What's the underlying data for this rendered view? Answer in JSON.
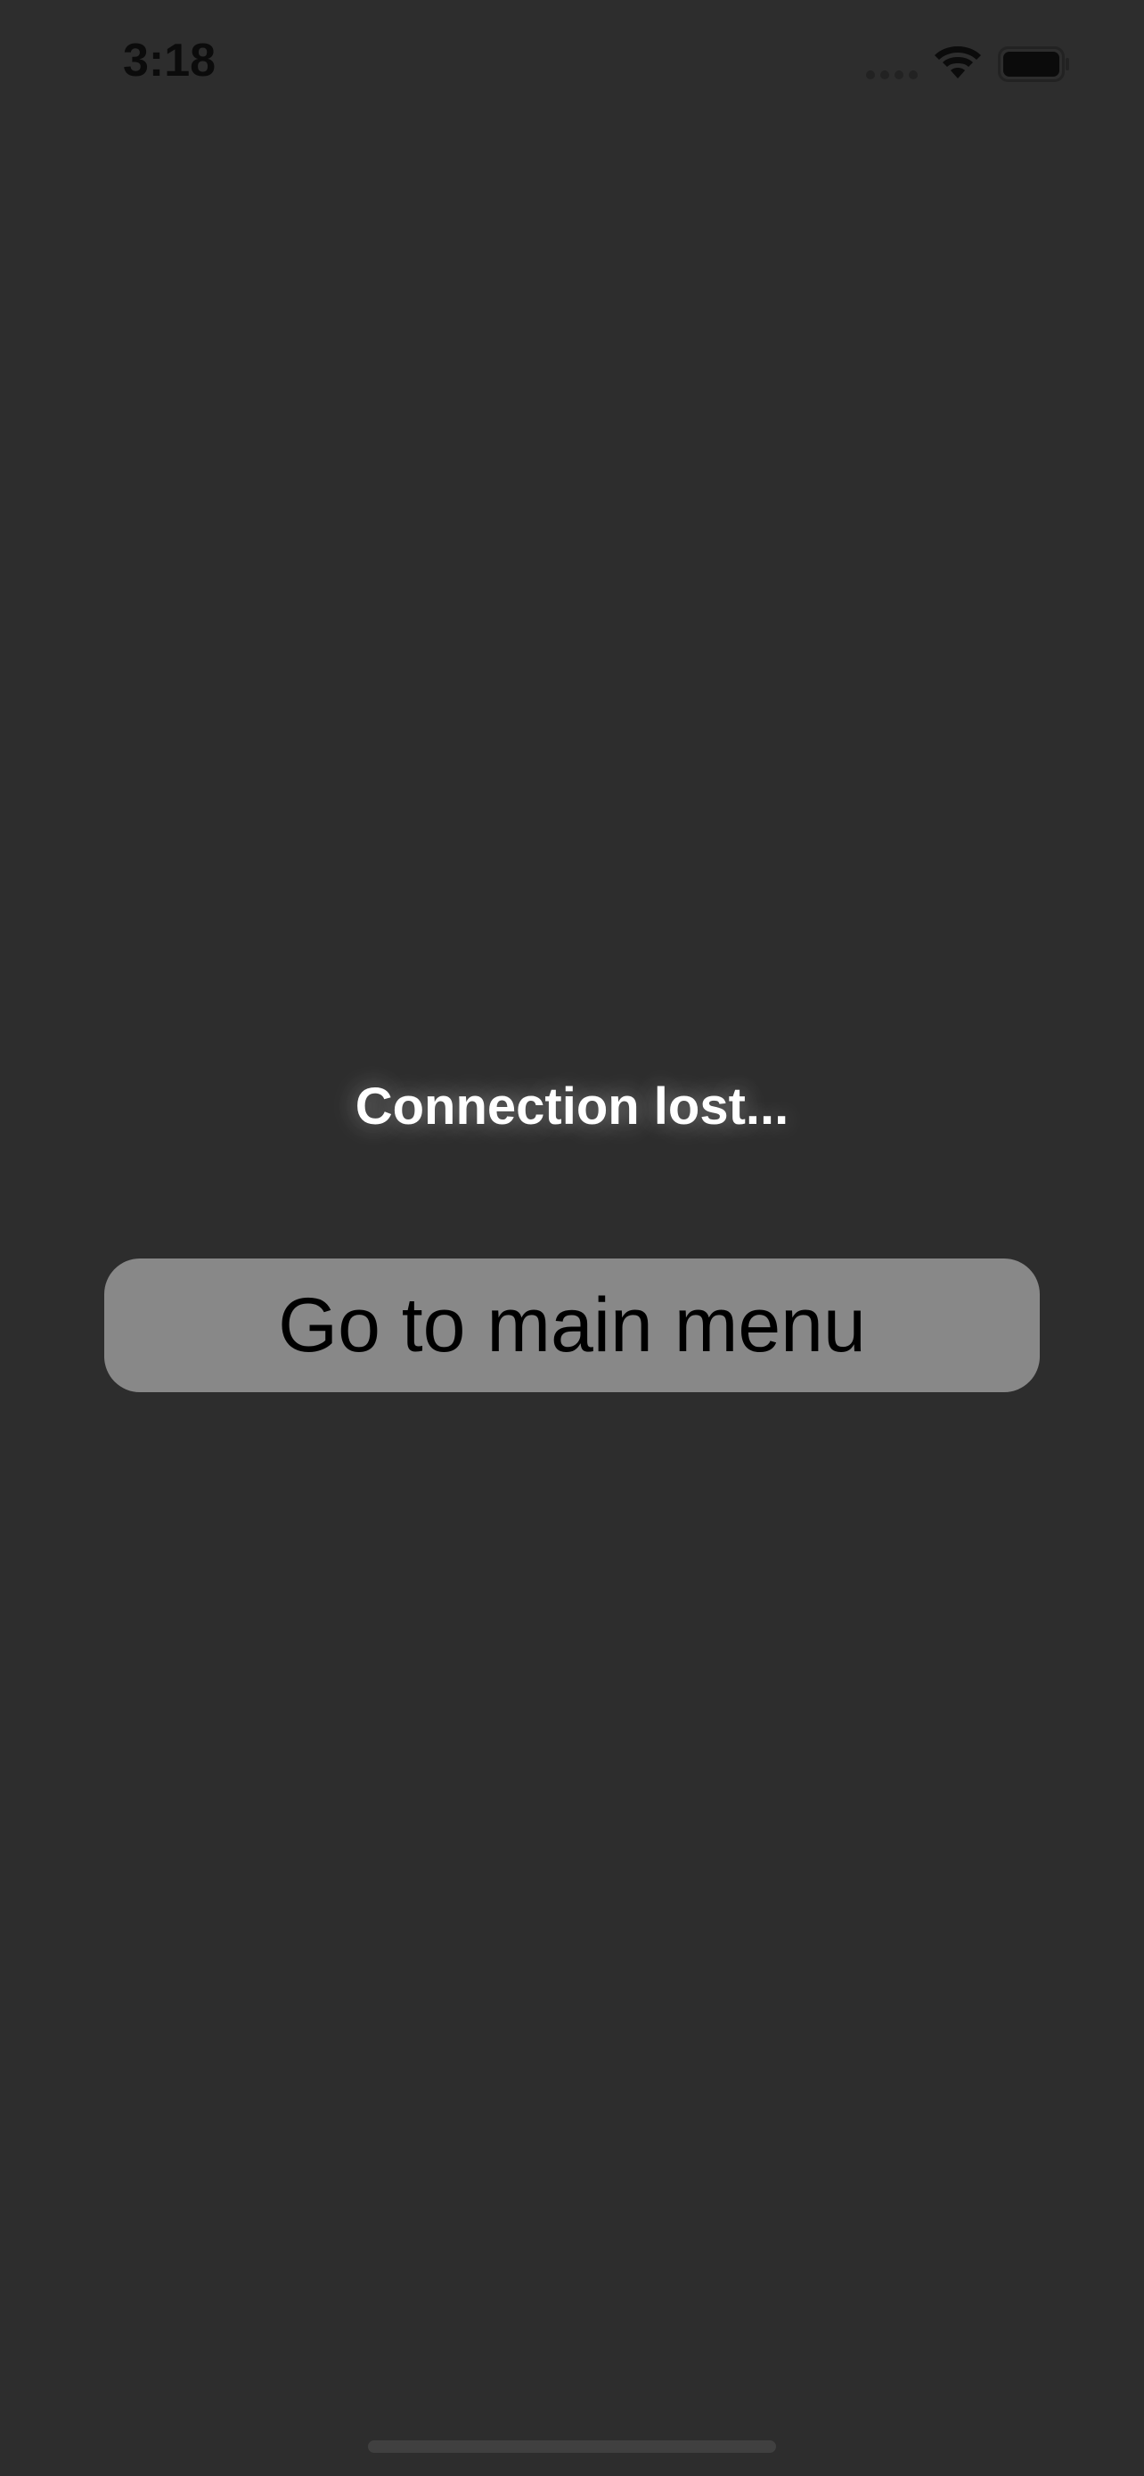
{
  "status_bar": {
    "time": "3:18",
    "wifi_icon": "wifi-icon",
    "battery_icon": "battery-icon",
    "signal_icon": "cellular-signal-dots-icon"
  },
  "main": {
    "message": "Connection lost...",
    "button_label": "Go to main menu"
  },
  "colors": {
    "background": "#2d2d2d",
    "button_background": "#888888",
    "message_text": "#ffffff",
    "button_text": "#000000"
  }
}
